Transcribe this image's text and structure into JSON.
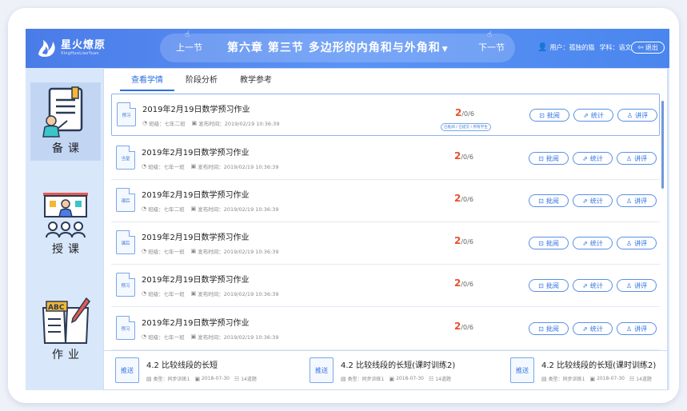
{
  "app": {
    "logo_cn": "星火燎原",
    "logo_en": "XingHuoLiaoYuan"
  },
  "header": {
    "prev_label": "上一节",
    "next_label": "下一节",
    "lesson_title": "第六章  第三节  多边形的内角和与外角和",
    "user_label": "用户：孤独的猫",
    "subject_label": "学科：语文",
    "logout_label": "退出"
  },
  "sidebar": {
    "items": [
      {
        "label": "备课",
        "icon": "lesson-prep-icon"
      },
      {
        "label": "授课",
        "icon": "teaching-icon"
      },
      {
        "label": "作业",
        "icon": "homework-icon"
      }
    ]
  },
  "tabs": [
    {
      "label": "查看学情"
    },
    {
      "label": "阶段分析"
    },
    {
      "label": "教学参考"
    }
  ],
  "list": {
    "rows": [
      {
        "tag": "预习",
        "title": "2019年2月19日数学预习作业",
        "class": "班级：七年二班",
        "time": "发布时间：2019/02/19  10:36:39",
        "count": "2",
        "total": "/0/6",
        "badge": "已批阅 / 已提交 / 所有学生"
      },
      {
        "tag": "当堂",
        "title": "2019年2月19日数学预习作业",
        "class": "班级：七年一班",
        "time": "发布时间：2019/02/19  10:36:39",
        "count": "2",
        "total": "/0/6",
        "badge": ""
      },
      {
        "tag": "课后",
        "title": "2019年2月19日数学预习作业",
        "class": "班级：七年二班",
        "time": "发布时间：2019/02/19  10:36:39",
        "count": "2",
        "total": "/0/6",
        "badge": ""
      },
      {
        "tag": "课后",
        "title": "2019年2月19日数学预习作业",
        "class": "班级：七年一班",
        "time": "发布时间：2019/02/19  10:36:39",
        "count": "2",
        "total": "/0/6",
        "badge": ""
      },
      {
        "tag": "预习",
        "title": "2019年2月19日数学预习作业",
        "class": "班级：七年一班",
        "time": "发布时间：2019/02/19  10:36:39",
        "count": "2",
        "total": "/0/6",
        "badge": ""
      },
      {
        "tag": "预习",
        "title": "2019年2月19日数学预习作业",
        "class": "班级：七年一班",
        "time": "发布时间：2019/02/19  10:36:39",
        "count": "2",
        "total": "/0/6",
        "badge": ""
      }
    ],
    "actions": {
      "review": "批阅",
      "stats": "统计",
      "comment": "讲评"
    }
  },
  "push": {
    "badge": "推送",
    "items": [
      {
        "title": "4.2 比较线段的长短",
        "type": "类型：同步训练1",
        "date": "2018-07-30",
        "count": "14道题"
      },
      {
        "title": "4.2 比较线段的长短(课时训练2)",
        "type": "类型：同步训练1",
        "date": "2018-07-30",
        "count": "14道题"
      },
      {
        "title": "4.2 比较线段的长短(课时训练2)",
        "type": "类型：同步训练1",
        "date": "2018-07-30",
        "count": "14道题"
      }
    ]
  },
  "colors": {
    "header": "#4a7ce8",
    "accent": "#2c6fe0",
    "count": "#e8502e",
    "sidebar": "#d9e7fb"
  }
}
